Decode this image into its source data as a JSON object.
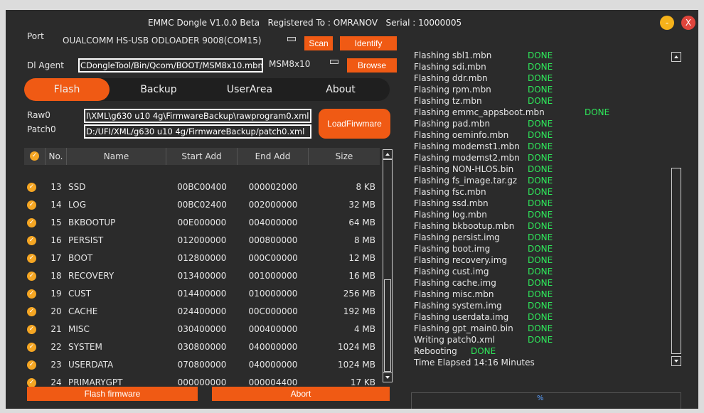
{
  "window": {
    "title": "EMMC Dongle V1.0.0 Beta   Registered To : OMRANOV   Serial : 10000005",
    "minimize": "-",
    "close": "X"
  },
  "port": {
    "label": "Port",
    "value": "OUALCOMM HS-USB ODLOADER 9008(COM15)",
    "scan": "Scan",
    "identify": "Identify"
  },
  "agent": {
    "label": "Dl  Agent",
    "path": "CDongleTool/Bin/Qcom/BOOT/MSM8x10.mbn",
    "chip": "MSM8x10",
    "browse": "Browse"
  },
  "tabs": [
    "Flash",
    "Backup",
    "UserArea",
    "About"
  ],
  "raw": {
    "raw_label": "Raw0",
    "raw_path": "I\\XML\\g630 u10 4g\\FirmwareBackup\\rawprogram0.xml",
    "patch_label": "Patch0",
    "patch_path": "D:/UFI/XML/g630 u10 4g/FirmwareBackup/patch0.xml",
    "load": "LoadFirwmare"
  },
  "table": {
    "headers": [
      "No.",
      "Name",
      "Start Add",
      "End Add",
      "Size"
    ],
    "rows": [
      [
        "13",
        "SSD",
        "00BC00400",
        "000002000",
        "8 KB"
      ],
      [
        "14",
        "LOG",
        "00BC02400",
        "002000000",
        "32 MB"
      ],
      [
        "15",
        "BKBOOTUP",
        "00E000000",
        "004000000",
        "64 MB"
      ],
      [
        "16",
        "PERSIST",
        "012000000",
        "000800000",
        "8 MB"
      ],
      [
        "17",
        "BOOT",
        "012800000",
        "000C00000",
        "12 MB"
      ],
      [
        "18",
        "RECOVERY",
        "013400000",
        "001000000",
        "16 MB"
      ],
      [
        "19",
        "CUST",
        "014400000",
        "010000000",
        "256 MB"
      ],
      [
        "20",
        "CACHE",
        "024400000",
        "00C000000",
        "192 MB"
      ],
      [
        "21",
        "MISC",
        "030400000",
        "000400000",
        "4 MB"
      ],
      [
        "22",
        "SYSTEM",
        "030800000",
        "040000000",
        "1024 MB"
      ],
      [
        "23",
        "USERDATA",
        "070800000",
        "040000000",
        "1024 MB"
      ],
      [
        "24",
        "PRIMARYGPT",
        "000000000",
        "000004400",
        "17 KB"
      ]
    ]
  },
  "actions": {
    "flash": "Flash firmware",
    "abort": "Abort"
  },
  "log": {
    "lines": [
      [
        "Flashing  sbl1.mbn",
        "DONE",
        0
      ],
      [
        "Flashing  sdi.mbn",
        "DONE",
        0
      ],
      [
        "Flashing  ddr.mbn",
        "DONE",
        0
      ],
      [
        "Flashing  rpm.mbn",
        "DONE",
        0
      ],
      [
        "Flashing  tz.mbn",
        "DONE",
        0
      ],
      [
        "Flashing  emmc_appsboot.mbn",
        "DONE",
        1
      ],
      [
        "Flashing  pad.mbn",
        "DONE",
        0
      ],
      [
        "Flashing  oeminfo.mbn",
        "DONE",
        0
      ],
      [
        "Flashing  modemst1.mbn",
        "DONE",
        0
      ],
      [
        "Flashing  modemst2.mbn",
        "DONE",
        0
      ],
      [
        "Flashing  NON-HLOS.bin",
        "DONE",
        0
      ],
      [
        "Flashing  fs_image.tar.gz",
        "DONE",
        0
      ],
      [
        "Flashing  fsc.mbn",
        "DONE",
        0
      ],
      [
        "Flashing  ssd.mbn",
        "DONE",
        0
      ],
      [
        "Flashing  log.mbn",
        "DONE",
        0
      ],
      [
        "Flashing  bkbootup.mbn",
        "DONE",
        0
      ],
      [
        "Flashing  persist.img",
        "DONE",
        0
      ],
      [
        "Flashing  boot.img",
        "DONE",
        0
      ],
      [
        "Flashing  recovery.img",
        "DONE",
        0
      ],
      [
        "Flashing  cust.img",
        "DONE",
        0
      ],
      [
        "Flashing  cache.img",
        "DONE",
        0
      ],
      [
        "Flashing  misc.mbn",
        "DONE",
        0
      ],
      [
        "Flashing  system.img",
        "DONE",
        0
      ],
      [
        "Flashing  userdata.img",
        "DONE",
        0
      ],
      [
        "Flashing  gpt_main0.bin",
        "DONE",
        0
      ],
      [
        "Writing patch0.xml",
        "DONE",
        0
      ],
      [
        "Rebooting",
        "DONE",
        2
      ],
      [
        "Time Elapsed 14:16  Minutes",
        "",
        0
      ]
    ]
  },
  "progress": {
    "text": "%",
    "percent": 0
  }
}
